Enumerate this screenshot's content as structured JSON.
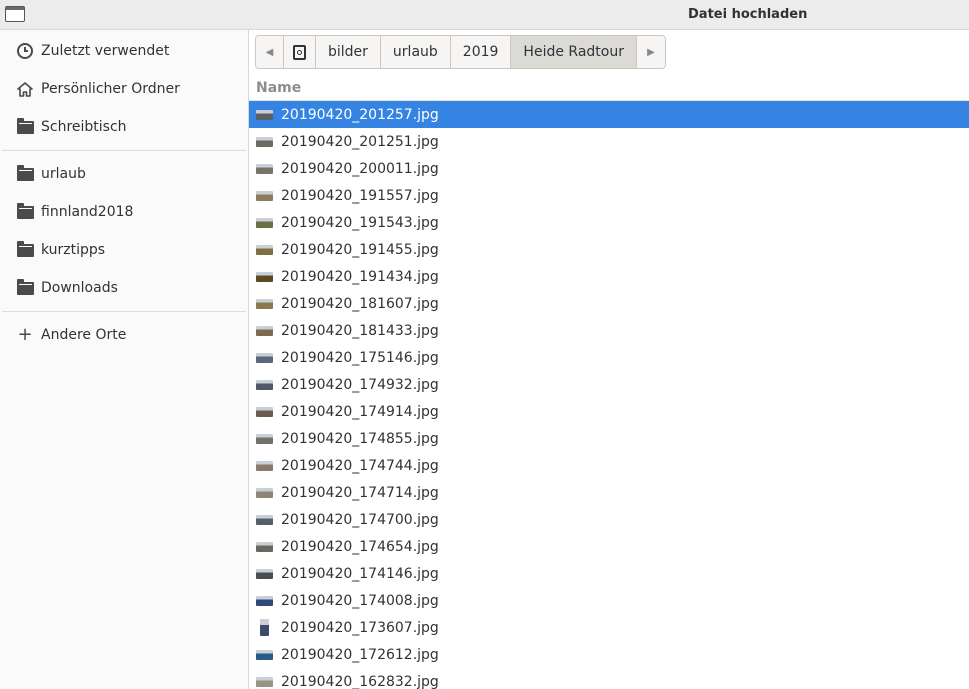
{
  "window": {
    "title": "Datei hochladen"
  },
  "sidebar": {
    "items": [
      {
        "label": "Zuletzt verwendet",
        "icon": "clock-icon"
      },
      {
        "label": "Persönlicher Ordner",
        "icon": "home-icon"
      },
      {
        "label": "Schreibtisch",
        "icon": "folder-icon"
      },
      {
        "label": "urlaub",
        "icon": "folder-icon"
      },
      {
        "label": "finnland2018",
        "icon": "folder-icon"
      },
      {
        "label": "kurztipps",
        "icon": "folder-icon"
      },
      {
        "label": "Downloads",
        "icon": "folder-icon"
      },
      {
        "label": "Andere Orte",
        "icon": "plus-icon"
      }
    ]
  },
  "pathbar": {
    "back_icon": "chevron-left-icon",
    "home_icon": "home-device-icon",
    "segments": [
      "bilder",
      "urlaub",
      "2019",
      "Heide Radtour"
    ],
    "forward_icon": "chevron-right-icon",
    "active_segment": "Heide Radtour"
  },
  "file_list": {
    "column_header": "Name",
    "selected_index": 0,
    "files": [
      "20190420_201257.jpg",
      "20190420_201251.jpg",
      "20190420_200011.jpg",
      "20190420_191557.jpg",
      "20190420_191543.jpg",
      "20190420_191455.jpg",
      "20190420_191434.jpg",
      "20190420_181607.jpg",
      "20190420_181433.jpg",
      "20190420_175146.jpg",
      "20190420_174932.jpg",
      "20190420_174914.jpg",
      "20190420_174855.jpg",
      "20190420_174744.jpg",
      "20190420_174714.jpg",
      "20190420_174700.jpg",
      "20190420_174654.jpg",
      "20190420_174146.jpg",
      "20190420_174008.jpg",
      "20190420_173607.jpg",
      "20190420_172612.jpg",
      "20190420_162832.jpg"
    ],
    "thumb_colors": [
      "#5a5f66",
      "#6d6a60",
      "#7a7468",
      "#8a7d5c",
      "#6b7044",
      "#7e6f3e",
      "#5d4a22",
      "#8c7a4e",
      "#7d6a50",
      "#5a6a7c",
      "#4e5866",
      "#6e5c4c",
      "#75706a",
      "#8a7a6c",
      "#8e8478",
      "#56606a",
      "#6c6660",
      "#4a4e52",
      "#2d4a78",
      "#3d4a6a",
      "#2a5a88",
      "#9a9484"
    ],
    "portrait_index": 19,
    "selection_color": "#3584e4"
  }
}
